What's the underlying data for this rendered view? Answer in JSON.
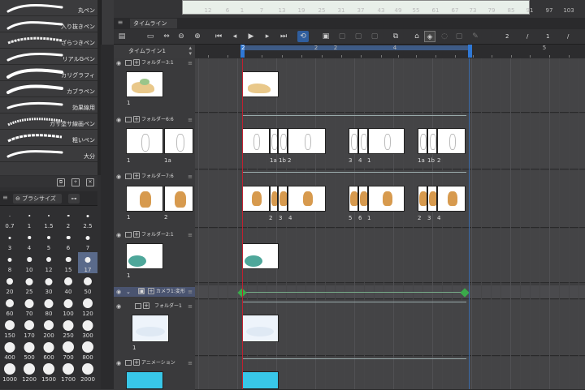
{
  "brushes": [
    {
      "label": "丸ペン"
    },
    {
      "label": "入り抜きペン"
    },
    {
      "label": "ざらつきペン"
    },
    {
      "label": "リアルGペン"
    },
    {
      "label": "カリグラフィ"
    },
    {
      "label": "カブラペン"
    },
    {
      "label": "効果線用"
    },
    {
      "label": "ガサ塗サ線画ペン"
    },
    {
      "label": "粗いペン"
    },
    {
      "label": "大分"
    }
  ],
  "brush_size_panel": {
    "title": "ブラシサイズ"
  },
  "brush_sizes": [
    "0.7",
    "1",
    "1.5",
    "2",
    "2.5",
    "3",
    "4",
    "5",
    "6",
    "7",
    "8",
    "10",
    "12",
    "15",
    "17",
    "20",
    "25",
    "30",
    "40",
    "50",
    "60",
    "70",
    "80",
    "100",
    "120",
    "150",
    "170",
    "200",
    "250",
    "300",
    "400",
    "500",
    "600",
    "700",
    "800",
    "1000",
    "1200",
    "1500",
    "1700",
    "2000"
  ],
  "brush_size_selected": "17",
  "timeline": {
    "tab_label": "タイムライン",
    "name": "タイムライン1",
    "toolbar_numbers": [
      "2",
      "/",
      "1",
      "/"
    ],
    "ruler_ticks": [
      "12",
      "6",
      "1",
      "7",
      "13",
      "19",
      "25",
      "31",
      "37",
      "43",
      "49",
      "55",
      "61",
      "67",
      "73",
      "79",
      "85",
      "91",
      "97",
      "103"
    ],
    "ruler_sub": [
      "2",
      "2",
      "4",
      "5"
    ],
    "playhead_label": "2"
  },
  "layers": [
    {
      "name": "フォルダー3:1",
      "caption": "1"
    },
    {
      "name": "フォルダー6:6",
      "captions": [
        "1",
        "1a"
      ]
    },
    {
      "name": "フォルダー7:6",
      "captions": [
        "1",
        "2"
      ]
    },
    {
      "name": "フォルダー2:1",
      "caption": "1"
    },
    {
      "name": "カメラ1:変形"
    },
    {
      "name": "フォルダー1",
      "caption": "1"
    },
    {
      "name": "アニメーション"
    }
  ],
  "cell_labels": {
    "row2": [
      "1a",
      "1b",
      "2",
      "3",
      "4",
      "1",
      "1a",
      "1b",
      "2"
    ],
    "row3": [
      "2",
      "3",
      "4",
      "5",
      "6",
      "1",
      "2",
      "3",
      "4"
    ]
  },
  "colors": {
    "accent": "#2f78d6",
    "playhead": "#c02030",
    "keyframe": "#3aaa4a",
    "selected": "#5a6a8a"
  }
}
